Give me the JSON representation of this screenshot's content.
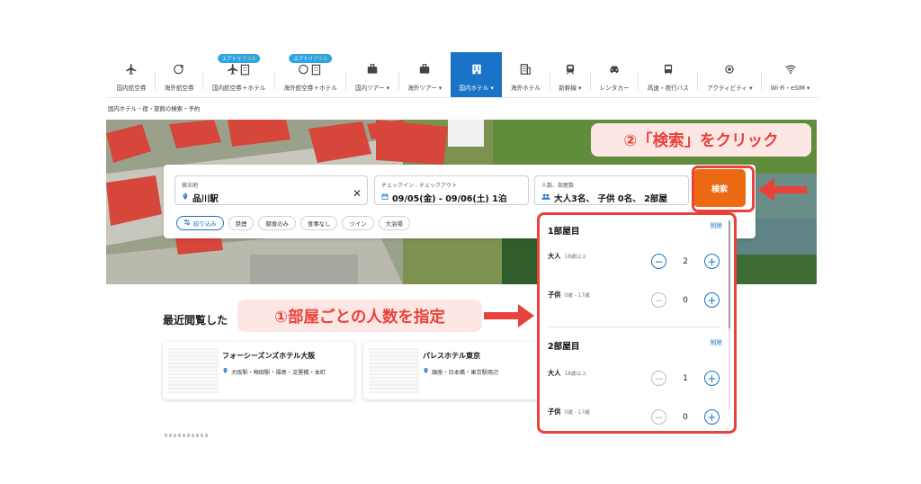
{
  "nav": {
    "items": [
      {
        "label": "国内航空券",
        "icon": "plane-icon"
      },
      {
        "label": "海外航空券",
        "icon": "globe-plane-icon"
      },
      {
        "label": "国内航空券＋ホテル",
        "icon": "plane-hotel-icon",
        "badge": "エアトリプラス"
      },
      {
        "label": "海外航空券＋ホテル",
        "icon": "globe-hotel-icon",
        "badge": "エアトリプラス"
      },
      {
        "label": "国内ツアー ▾",
        "icon": "suitcase-icon"
      },
      {
        "label": "海外ツアー ▾",
        "icon": "suitcase-icon"
      },
      {
        "label": "国内ホテル ▾",
        "icon": "hotel-icon",
        "active": true
      },
      {
        "label": "海外ホテル",
        "icon": "building-icon"
      },
      {
        "label": "新幹線 ▾",
        "icon": "train-icon"
      },
      {
        "label": "レンタカー",
        "icon": "car-icon"
      },
      {
        "label": "高速・夜行バス",
        "icon": "bus-icon"
      },
      {
        "label": "アクティビティ ▾",
        "icon": "activity-icon"
      },
      {
        "label": "Wi-Fi・eSIM ▾",
        "icon": "wifi-icon"
      }
    ]
  },
  "breadcrumb": "国内ホテル・宿・旅館の検索・予約",
  "search": {
    "dest_label": "宿泊地",
    "dest_value": "品川駅",
    "date_label": "チェックイン - チェックアウト",
    "date_value": "09/05(金) - 09/06(土) 1泊",
    "guest_label": "人数、部屋数",
    "guest_value": "大人3名、 子供 0名、 2部屋",
    "button": "検索"
  },
  "chips": [
    "絞り込み",
    "禁煙",
    "朝食のみ",
    "食事なし",
    "ツイン",
    "大浴場"
  ],
  "recent": {
    "title": "最近閲覧した",
    "hotels": [
      {
        "name": "フォーシーズンズホテル大阪",
        "location": "大阪駅・梅田駅・福島・淀屋橋・本町"
      },
      {
        "name": "パレスホテル東京",
        "location": "銀座・日本橋・東京駅周辺"
      }
    ]
  },
  "rooms": [
    {
      "title": "1部屋目",
      "delete": "削除",
      "adult_label": "大人",
      "adult_sub": "18歳以上",
      "adults": "2",
      "child_label": "子供",
      "child_sub": "0歳 - 17歳",
      "children": "0"
    },
    {
      "title": "2部屋目",
      "delete": "削除",
      "adult_label": "大人",
      "adult_sub": "18歳以上",
      "adults": "1",
      "child_label": "子供",
      "child_sub": "0歳 - 17歳",
      "children": "0"
    }
  ],
  "annotations": {
    "step1": "①部屋ごとの人数を指定",
    "step2": "②「検索」をクリック"
  },
  "colors": {
    "accent": "#1a73c6",
    "search": "#ec6a12",
    "annotation": "#e8423a"
  }
}
